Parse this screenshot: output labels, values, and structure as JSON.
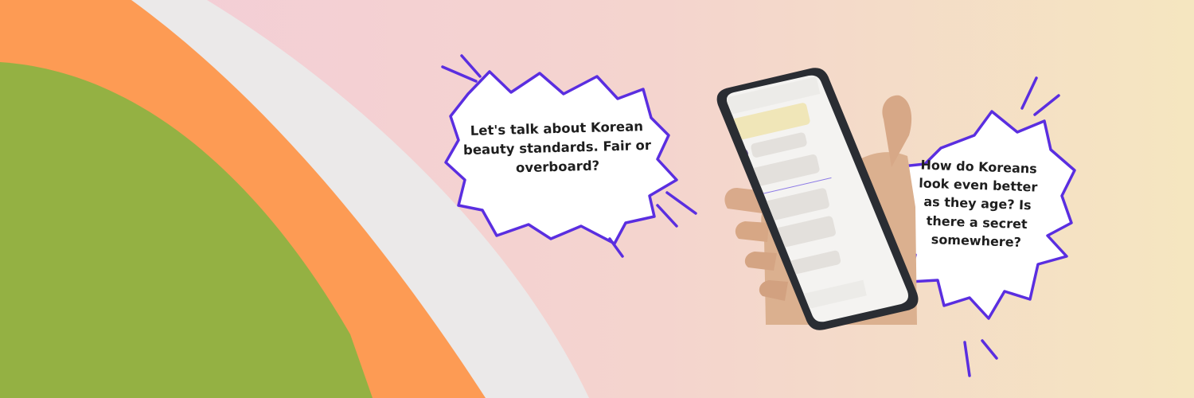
{
  "colors": {
    "background_left": "#f3ccd9",
    "background_right": "#f5e6c0",
    "orange_band": "#fd9b54",
    "grey_band": "#ebe9e9",
    "green_shape": "#94b143",
    "bubble_outline": "#5a2ee0",
    "phone_frame": "#2a2d33",
    "chat_bubble": "#e3e0dc",
    "highlight_bubble": "#f0e6b8"
  },
  "bubbles": {
    "left": {
      "text": "Let's talk about Korean beauty standards. Fair or overboard?"
    },
    "right": {
      "text": "How do Koreans look even better as they age? Is there a secret somewhere?"
    }
  },
  "icons": {
    "phone": "phone-icon",
    "hand": "hand-icon",
    "speech_left": "speech-bubble-icon",
    "speech_right": "speech-bubble-icon"
  }
}
